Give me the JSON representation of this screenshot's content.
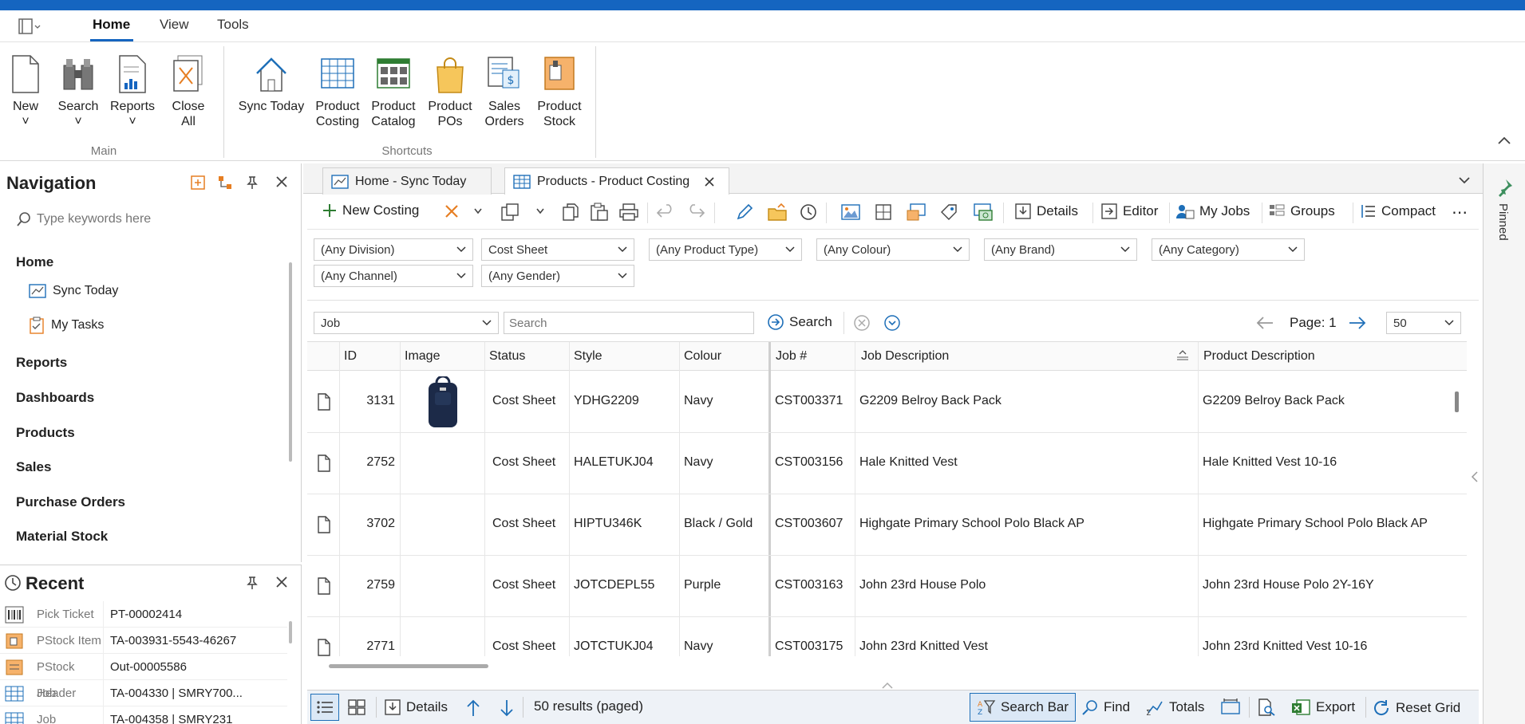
{
  "menu": {
    "home": "Home",
    "view": "View",
    "tools": "Tools"
  },
  "ribbon": {
    "main": {
      "label": "Main",
      "buttons": [
        {
          "line1": "New",
          "line2": "˅"
        },
        {
          "line1": "Search",
          "line2": "˅"
        },
        {
          "line1": "Reports",
          "line2": "˅"
        },
        {
          "line1": "Close",
          "line2": "All"
        }
      ]
    },
    "shortcuts": {
      "label": "Shortcuts",
      "buttons": [
        {
          "line1": "Sync Today",
          "line2": ""
        },
        {
          "line1": "Product",
          "line2": "Costing"
        },
        {
          "line1": "Product",
          "line2": "Catalog"
        },
        {
          "line1": "Product",
          "line2": "POs"
        },
        {
          "line1": "Sales",
          "line2": "Orders"
        },
        {
          "line1": "Product",
          "line2": "Stock"
        }
      ]
    }
  },
  "nav": {
    "title": "Navigation",
    "search_placeholder": "Type keywords here",
    "home": "Home",
    "sync_today": "Sync Today",
    "my_tasks": "My Tasks",
    "reports": "Reports",
    "dashboards": "Dashboards",
    "products": "Products",
    "sales": "Sales",
    "purchase_orders": "Purchase Orders",
    "material_stock": "Material Stock"
  },
  "recent": {
    "title": "Recent",
    "items": [
      {
        "type": "Pick Ticket",
        "value": "PT-00002414"
      },
      {
        "type": "PStock Item",
        "value": "TA-003931-5543-46267"
      },
      {
        "type": "PStock Header",
        "value": "Out-00005586"
      },
      {
        "type": "Job",
        "value": "TA-004330 | SMRY700..."
      },
      {
        "type": "Job",
        "value": "TA-004358 | SMRY231"
      }
    ]
  },
  "tabs": [
    {
      "label": "Home - Sync Today"
    },
    {
      "label": "Products - Product Costing"
    }
  ],
  "toolbar": {
    "new_costing": "New Costing",
    "details": "Details",
    "editor": "Editor",
    "my_jobs": "My Jobs",
    "groups": "Groups",
    "compact": "Compact",
    "more": "⋯"
  },
  "filters": {
    "division": "(Any Division)",
    "cost_sheet": "Cost Sheet",
    "product_type": "(Any Product Type)",
    "colour": "(Any Colour)",
    "brand": "(Any Brand)",
    "category": "(Any Category)",
    "channel": "(Any Channel)",
    "gender": "(Any Gender)"
  },
  "search": {
    "field": "Job",
    "placeholder": "Search",
    "button": "Search",
    "page_label": "Page: 1",
    "page_size": "50"
  },
  "grid": {
    "columns": {
      "id": "ID",
      "image": "Image",
      "status": "Status",
      "style": "Style",
      "colour": "Colour",
      "job_no": "Job #",
      "job_desc": "Job Description",
      "prod_desc": "Product Description"
    },
    "rows": [
      {
        "id": "3131",
        "status": "Cost Sheet",
        "style": "YDHG2209",
        "colour": "Navy",
        "job": "CST003371",
        "job_desc": "G2209  Belroy Back Pack",
        "prod_desc": "G2209  Belroy Back Pack"
      },
      {
        "id": "2752",
        "status": "Cost Sheet",
        "style": "HALETUKJ04",
        "colour": "Navy",
        "job": "CST003156",
        "job_desc": "Hale Knitted Vest",
        "prod_desc": "Hale Knitted Vest 10-16"
      },
      {
        "id": "3702",
        "status": "Cost Sheet",
        "style": "HIPTU346K",
        "colour": "Black / Gold",
        "job": "CST003607",
        "job_desc": "Highgate Primary School Polo Black AP",
        "prod_desc": "Highgate Primary School Polo Black AP"
      },
      {
        "id": "2759",
        "status": "Cost Sheet",
        "style": "JOTCDEPL55",
        "colour": "Purple",
        "job": "CST003163",
        "job_desc": "John 23rd House Polo",
        "prod_desc": "John 23rd House Polo 2Y-16Y"
      },
      {
        "id": "2771",
        "status": "Cost Sheet",
        "style": "JOTCTUKJ04",
        "colour": "Navy",
        "job": "CST003175",
        "job_desc": "John 23rd Knitted Vest",
        "prod_desc": "John 23rd Knitted Vest 10-16"
      }
    ]
  },
  "statusbar": {
    "details": "Details",
    "results": "50 results (paged)",
    "search_bar": "Search Bar",
    "find": "Find",
    "totals": "Totals",
    "export": "Export",
    "reset_grid": "Reset Grid"
  },
  "rail": {
    "pinned": "Pinned"
  },
  "colors": {
    "accent": "#1565c0",
    "header": "#fafafa"
  }
}
